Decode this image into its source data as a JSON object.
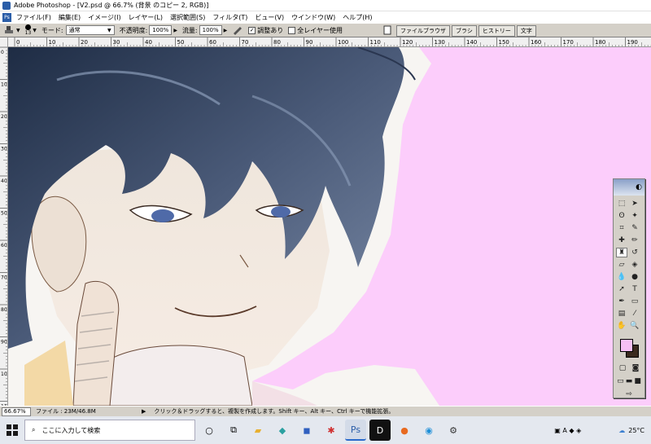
{
  "window": {
    "title": "Adobe Photoshop - [V2.psd @ 66.7% (背景 のコピー 2, RGB)]"
  },
  "menu": {
    "items": [
      "ファイル(F)",
      "編集(E)",
      "イメージ(I)",
      "レイヤー(L)",
      "選択範囲(S)",
      "フィルタ(T)",
      "ビュー(V)",
      "ウインドウ(W)",
      "ヘルプ(H)"
    ]
  },
  "options": {
    "brush_size": "13",
    "mode_label": "モード:",
    "mode_value": "通常",
    "opacity_label": "不透明度:",
    "opacity_value": "100%",
    "flow_label": "流量:",
    "flow_value": "100%",
    "aligned_label": "調整あり",
    "aligned_checked": "✓",
    "all_layers_label": "全レイヤー使用"
  },
  "palette_well": {
    "tabs": [
      "ファイルブラウザ",
      "ブラシ",
      "ヒストリー",
      "文字"
    ]
  },
  "rulers": {
    "h_ticks": [
      "0",
      "10",
      "20",
      "30",
      "40",
      "50",
      "60",
      "70",
      "80",
      "90",
      "100",
      "110",
      "120",
      "130",
      "140",
      "150",
      "160",
      "170",
      "180",
      "190"
    ],
    "v_ticks": [
      "0",
      "10",
      "20",
      "30",
      "40",
      "50",
      "60",
      "70",
      "80",
      "90",
      "100",
      "110",
      "120",
      "130",
      "140",
      "150",
      "160",
      "170",
      "180",
      "190"
    ]
  },
  "toolbox": {
    "tools": [
      "marquee-tool",
      "move-tool",
      "lasso-tool",
      "magic-wand-tool",
      "crop-tool",
      "slice-tool",
      "healing-brush-tool",
      "brush-tool",
      "clone-stamp-tool",
      "history-brush-tool",
      "eraser-tool",
      "paint-bucket-tool",
      "blur-tool",
      "dodge-tool",
      "path-selection-tool",
      "type-tool",
      "pen-tool",
      "shape-tool",
      "notes-tool",
      "eyedropper-tool",
      "hand-tool",
      "zoom-tool"
    ],
    "foreground": "#f7c0f5",
    "background": "#3a2a1e"
  },
  "status": {
    "zoom": "66.67%",
    "doc_size": "ファイル : 23M/46.8M",
    "hint": "クリック＆ドラッグすると、複製を作成します。Shift キー、Alt キー、Ctrl キーで機能拡張。"
  },
  "taskbar": {
    "search_placeholder": "ここに入力して検索",
    "weather": "25°C"
  },
  "canvas": {
    "background": "#fccdfb"
  }
}
